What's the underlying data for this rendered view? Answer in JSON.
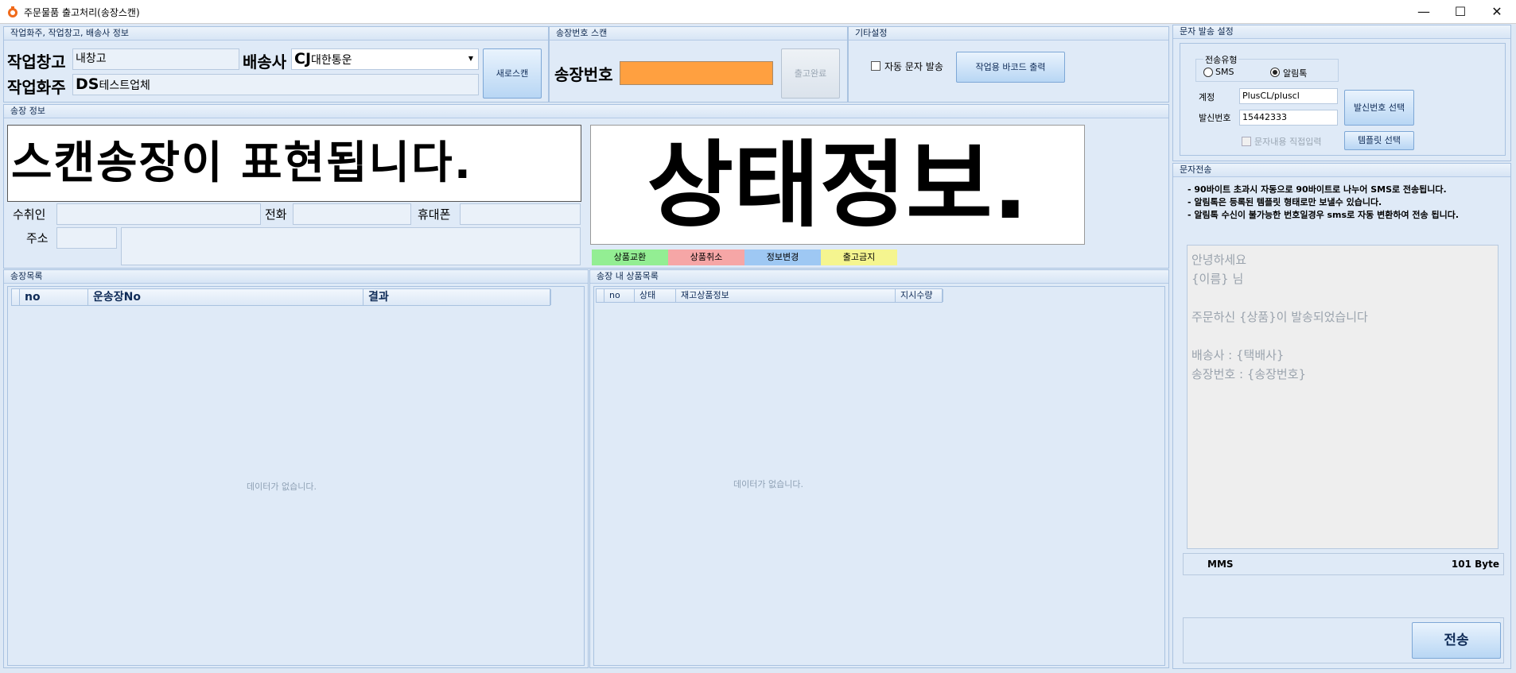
{
  "window": {
    "title": "주문물품 출고처리(송장스캔)",
    "min_label": "—",
    "max_label": "☐",
    "close_label": "✕"
  },
  "work_panel": {
    "header": "작업화주, 작업창고, 배송사 정보",
    "warehouse_label": "작업창고",
    "warehouse_value": "내창고",
    "carrier_label": "배송사",
    "carrier_prefix": "CJ",
    "carrier_value": "대한통운",
    "owner_label": "작업화주",
    "owner_prefix": "DS",
    "owner_value": "테스트업체",
    "new_scan_button": "새로스캔"
  },
  "scan_panel": {
    "header": "송장번호 스캔",
    "invoice_label": "송장번호",
    "invoice_value": "",
    "complete_button": "출고완료"
  },
  "misc_panel": {
    "header": "기타설정",
    "auto_sms_label": "자동 문자 발송",
    "print_button": "작업용 바코드 출력"
  },
  "invoice_info": {
    "header": "송장 정보",
    "scan_text": "스캔송장이 표현됩니다.",
    "status_text": "상태정보.",
    "receiver_label": "수취인",
    "phone_label": "전화",
    "mobile_label": "휴대폰",
    "address_label": "주소",
    "badges": [
      {
        "label": "상품교환",
        "color": "#93ee93"
      },
      {
        "label": "상품취소",
        "color": "#f6a6a6"
      },
      {
        "label": "정보변경",
        "color": "#9ec8f3"
      },
      {
        "label": "출고금지",
        "color": "#f5f58f"
      }
    ]
  },
  "invoice_list": {
    "header": "송장목록",
    "columns": [
      "no",
      "운송장No",
      "결과"
    ],
    "empty": "데이터가 없습니다."
  },
  "product_list": {
    "header": "송장 내 상품목록",
    "columns": [
      "no",
      "상태",
      "재고상품정보",
      "지시수량"
    ],
    "empty": "데이터가 없습니다."
  },
  "sms_settings": {
    "header": "문자 발송 설정",
    "send_type_label": "전송유형",
    "sms_label": "SMS",
    "alimtalk_label": "알림톡",
    "account_label": "계정",
    "account_value": "PlusCL/pluscl",
    "sender_label": "발신번호",
    "sender_value": "15442333",
    "sender_button": "발신번호 선택",
    "direct_input_label": "문자내용 직접입력",
    "template_button": "템플릿 선택"
  },
  "sms_send": {
    "header": "문자전송",
    "notes": [
      "- 90바이트 초과시 자동으로 90바이트로 나누어 SMS로 전송됩니다.",
      "- 알림톡은 등록된 템플릿 형태로만 보낼수 있습니다.",
      "- 알림톡 수신이 불가능한 번호일경우 sms로 자동 변환하여 전송 됩니다."
    ],
    "message_lines": [
      "안녕하세요",
      "{이름} 님",
      "",
      "주문하신 {상품}이 발송되었습니다",
      "",
      "배송사 : {택배사}",
      "송장번호 : {송장번호}"
    ],
    "mode": "MMS",
    "bytes": "101 Byte",
    "send_button": "전송"
  }
}
